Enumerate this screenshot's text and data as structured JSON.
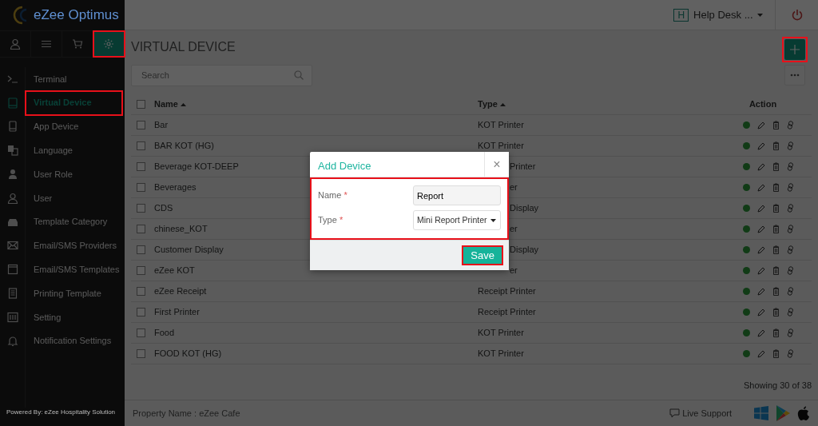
{
  "logo": {
    "text": "eZee Optimus"
  },
  "sidebar": {
    "tabs": [
      {
        "selected": false
      },
      {
        "selected": false
      },
      {
        "selected": false
      },
      {
        "selected": true
      }
    ],
    "items": [
      {
        "label": "Terminal",
        "selected": false
      },
      {
        "label": "Virtual Device",
        "selected": true
      },
      {
        "label": "App Device",
        "selected": false
      },
      {
        "label": "Language",
        "selected": false
      },
      {
        "label": "User Role",
        "selected": false
      },
      {
        "label": "User",
        "selected": false
      },
      {
        "label": "Template Category",
        "selected": false
      },
      {
        "label": "Email/SMS Providers",
        "selected": false
      },
      {
        "label": "Email/SMS Templates",
        "selected": false
      },
      {
        "label": "Printing Template",
        "selected": false
      },
      {
        "label": "Setting",
        "selected": false
      },
      {
        "label": "Notification Settings",
        "selected": false
      }
    ],
    "powered_by": "Powered By: eZee Hospitality Solution"
  },
  "header": {
    "badge": "H",
    "user": "Help Desk ..."
  },
  "page": {
    "title": "VIRTUAL DEVICE",
    "search": {
      "placeholder": "Search"
    }
  },
  "table": {
    "select_all_checked": false,
    "columns": [
      {
        "label": "Name",
        "sortable": true
      },
      {
        "label": "Type",
        "sortable": true
      },
      {
        "label": "Action",
        "sortable": false
      }
    ],
    "rows": [
      {
        "name": "Bar",
        "type": "KOT Printer",
        "covered": false,
        "checked": false,
        "active": true
      },
      {
        "name": "BAR KOT (HG)",
        "type": "KOT Printer",
        "covered": false,
        "checked": false,
        "active": true
      },
      {
        "name": "Beverage KOT-DEEP",
        "type": "Printer",
        "covered": true,
        "checked": false,
        "active": true
      },
      {
        "name": "Beverages",
        "type": "er",
        "covered": true,
        "checked": false,
        "active": true
      },
      {
        "name": "CDS",
        "type": "Display",
        "covered": true,
        "checked": false,
        "active": true
      },
      {
        "name": "chinese_KOT",
        "type": "er",
        "covered": true,
        "checked": false,
        "active": true
      },
      {
        "name": "Customer Display",
        "type": "Display",
        "covered": true,
        "checked": false,
        "active": true
      },
      {
        "name": "eZee KOT",
        "type": "er",
        "covered": true,
        "checked": false,
        "active": true
      },
      {
        "name": "eZee Receipt",
        "type": "Receipt Printer",
        "covered": false,
        "checked": false,
        "active": true
      },
      {
        "name": "First Printer",
        "type": "Receipt Printer",
        "covered": false,
        "checked": false,
        "active": true
      },
      {
        "name": "Food",
        "type": "KOT Printer",
        "covered": false,
        "checked": false,
        "active": true
      },
      {
        "name": "FOOD KOT (HG)",
        "type": "KOT Printer",
        "covered": false,
        "checked": false,
        "active": true
      }
    ],
    "showing": "Showing 30 of 38"
  },
  "footer": {
    "property": "Property Name : eZee Cafe",
    "support": "Live Support"
  },
  "modal": {
    "title": "Add Device",
    "close": "×",
    "fields": [
      {
        "label": "Name",
        "mark": "*",
        "kind": "text",
        "value": "Report"
      },
      {
        "label": "Type",
        "mark": "*",
        "kind": "select",
        "value": "Mini Report Printer"
      }
    ],
    "save": "Save"
  }
}
